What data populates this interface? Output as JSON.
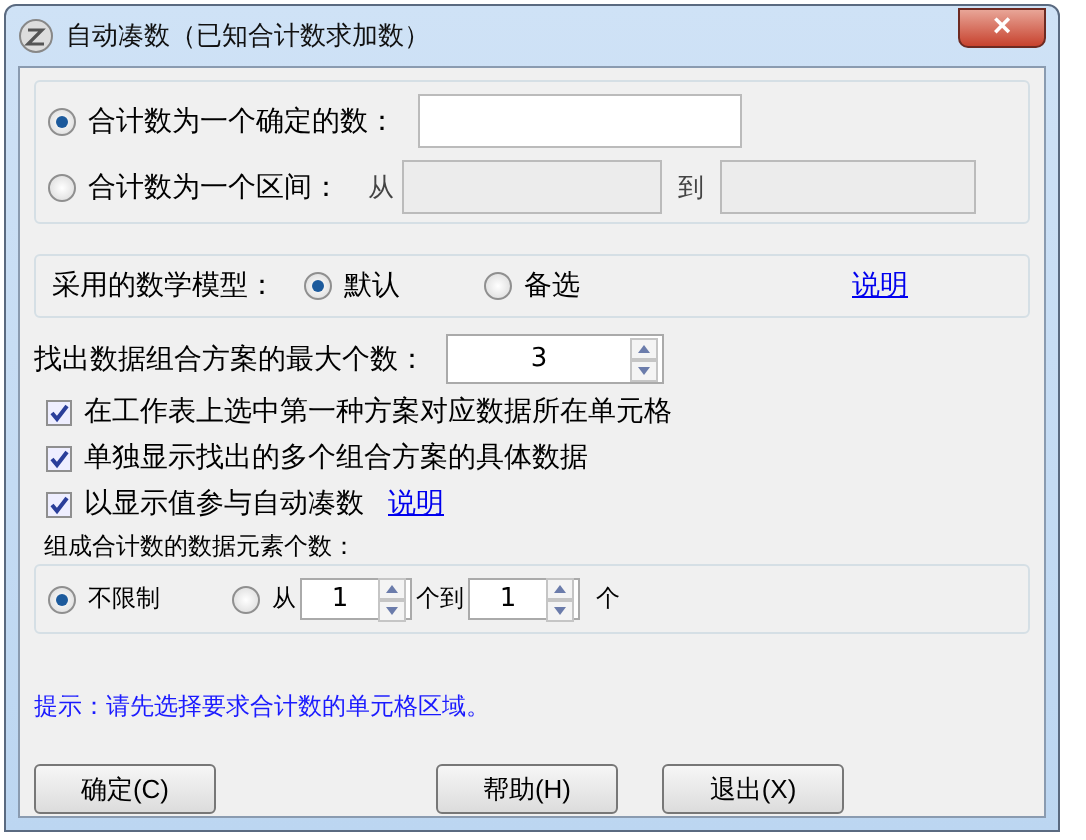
{
  "window": {
    "title": "自动凑数（已知合计数求加数）",
    "close": "×"
  },
  "target": {
    "options": [
      {
        "label": "合计数为一个确定的数：",
        "selected": true
      },
      {
        "label": "合计数为一个区间：",
        "selected": false
      }
    ],
    "from_label": "从",
    "to_label": "到"
  },
  "model": {
    "label": "采用的数学模型：",
    "options": [
      {
        "label": "默认",
        "selected": true
      },
      {
        "label": "备选",
        "selected": false
      }
    ],
    "link": "说明"
  },
  "max_count": {
    "label": "找出数据组合方案的最大个数：",
    "value": "3"
  },
  "checks": [
    {
      "label": "在工作表上选中第一种方案对应数据所在单元格",
      "checked": true
    },
    {
      "label": "单独显示找出的多个组合方案的具体数据",
      "checked": true
    },
    {
      "label": "以显示值参与自动凑数",
      "checked": true,
      "link": "说明"
    }
  ],
  "elements": {
    "legend": "组成合计数的数据元素个数：",
    "options": [
      {
        "label": "不限制",
        "selected": true
      },
      {
        "label": "从",
        "selected": false
      }
    ],
    "from_value": "1",
    "mid_label": "个到",
    "to_value": "1",
    "unit": "个"
  },
  "hint": "提示：请先选择要求合计数的单元格区域。",
  "buttons": [
    "确定(C)",
    "帮助(H)",
    "退出(X)"
  ]
}
